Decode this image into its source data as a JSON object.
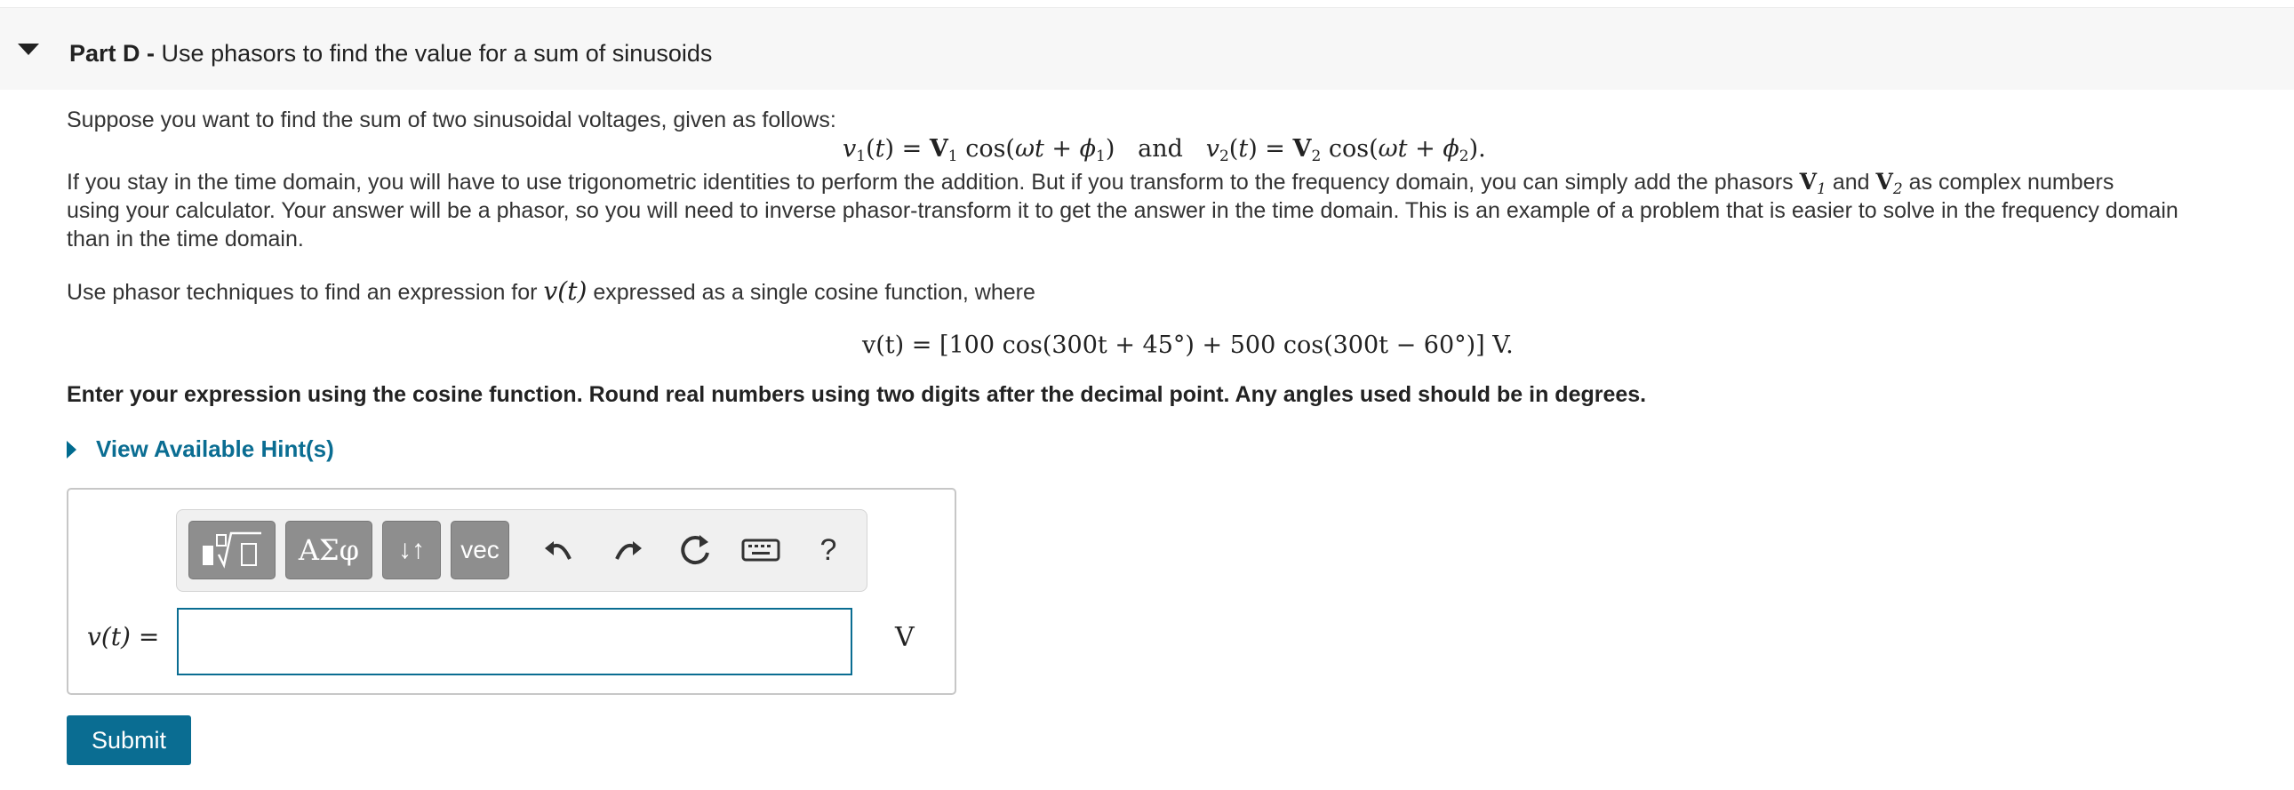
{
  "part": {
    "prefix": "Part D -",
    "title": "Use phasors to find the value for a sum of sinusoids"
  },
  "body": {
    "intro": "Suppose you want to find the sum of two sinusoidal voltages, given as follows:",
    "eq1_word": "and",
    "para2_a": "If you stay in the time domain, you will have to use trigonometric identities to perform the addition.  But if you transform to the frequency domain, you can simply add the phasors",
    "para2_and": "and",
    "para2_b": "as complex numbers",
    "para2_line2": "using your calculator. Your answer will be a phasor, so you will need to inverse phasor-transform it to get the answer in the time domain.  This is an example of a problem that is easier to solve in the frequency domain",
    "para2_line3": "than in the time domain.",
    "para3_a": "Use phasor techniques to find an expression for",
    "para3_b": "expressed as a single cosine function, where",
    "eq2": "v(t) = [100 cos(300t + 45°) + 500 cos(300t − 60°)] V.",
    "instructions": "Enter your expression using the cosine function. Round real numbers using two digits after the decimal point. Any angles used should be in degrees."
  },
  "hint": {
    "label": "View Available Hint(s)"
  },
  "toolbar": {
    "greek_label": "ΑΣφ",
    "arrows_label": "↓↑",
    "vec_label": "vec",
    "help_label": "?"
  },
  "answer": {
    "label": "v(t) =",
    "value": "",
    "unit": "V"
  },
  "submit_label": "Submit",
  "colors": {
    "accent": "#0a6d92",
    "toolbar_button": "#8e8e8e",
    "header_bg": "#f7f7f7"
  }
}
